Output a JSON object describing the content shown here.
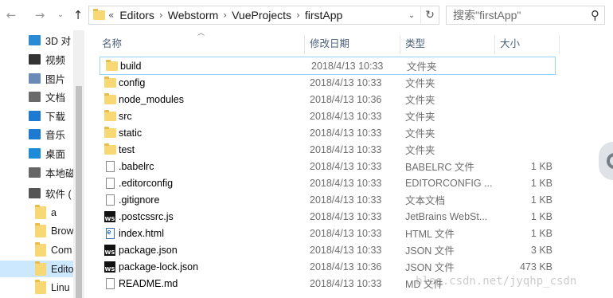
{
  "nav": {
    "back_icon": "back-arrow-icon",
    "forward_icon": "forward-arrow-icon",
    "recent_icon": "chevron-down-icon",
    "up_icon": "up-arrow-icon"
  },
  "address": {
    "overflow": "«",
    "crumbs": [
      "Editors",
      "Webstorm",
      "VueProjects",
      "firstApp"
    ],
    "separator": "›"
  },
  "search": {
    "placeholder": "搜索\"firstApp\""
  },
  "sidebar": {
    "items": [
      {
        "label": "3D 对",
        "icon": "3d-objects-icon"
      },
      {
        "label": "视频",
        "icon": "video-icon"
      },
      {
        "label": "图片",
        "icon": "pictures-icon"
      },
      {
        "label": "文档",
        "icon": "documents-icon"
      },
      {
        "label": "下载",
        "icon": "download-icon"
      },
      {
        "label": "音乐",
        "icon": "music-icon"
      },
      {
        "label": "桌面",
        "icon": "desktop-icon"
      },
      {
        "label": "本地磁",
        "icon": "local-disk-icon"
      },
      {
        "label": "软件 (",
        "icon": "drive-icon"
      },
      {
        "label": "a",
        "icon": "folder-icon"
      },
      {
        "label": "Brow",
        "icon": "folder-icon"
      },
      {
        "label": "Com",
        "icon": "folder-icon"
      },
      {
        "label": "Edito",
        "icon": "folder-icon",
        "selected": true
      },
      {
        "label": "Linu",
        "icon": "folder-icon"
      }
    ]
  },
  "columns": {
    "name": "名称",
    "date": "修改日期",
    "type": "类型",
    "size": "大小"
  },
  "files": [
    {
      "name": "build",
      "date": "2018/4/13 10:33",
      "type": "文件夹",
      "size": "",
      "icon": "folder-icon"
    },
    {
      "name": "config",
      "date": "2018/4/13 10:33",
      "type": "文件夹",
      "size": "",
      "icon": "folder-icon"
    },
    {
      "name": "node_modules",
      "date": "2018/4/13 10:36",
      "type": "文件夹",
      "size": "",
      "icon": "folder-icon"
    },
    {
      "name": "src",
      "date": "2018/4/13 10:33",
      "type": "文件夹",
      "size": "",
      "icon": "folder-icon"
    },
    {
      "name": "static",
      "date": "2018/4/13 10:33",
      "type": "文件夹",
      "size": "",
      "icon": "folder-icon"
    },
    {
      "name": "test",
      "date": "2018/4/13 10:33",
      "type": "文件夹",
      "size": "",
      "icon": "folder-icon"
    },
    {
      "name": ".babelrc",
      "date": "2018/4/13 10:33",
      "type": "BABELRC 文件",
      "size": "1 KB",
      "icon": "file-icon"
    },
    {
      "name": ".editorconfig",
      "date": "2018/4/13 10:33",
      "type": "EDITORCONFIG ...",
      "size": "1 KB",
      "icon": "file-icon"
    },
    {
      "name": ".gitignore",
      "date": "2018/4/13 10:33",
      "type": "文本文档",
      "size": "1 KB",
      "icon": "file-icon"
    },
    {
      "name": ".postcssrc.js",
      "date": "2018/4/13 10:33",
      "type": "JetBrains WebSt...",
      "size": "1 KB",
      "icon": "webstorm-icon"
    },
    {
      "name": "index.html",
      "date": "2018/4/13 10:33",
      "type": "HTML 文件",
      "size": "1 KB",
      "icon": "html-file-icon"
    },
    {
      "name": "package.json",
      "date": "2018/4/13 10:33",
      "type": "JSON 文件",
      "size": "3 KB",
      "icon": "webstorm-icon"
    },
    {
      "name": "package-lock.json",
      "date": "2018/4/13 10:36",
      "type": "JSON 文件",
      "size": "473 KB",
      "icon": "webstorm-icon"
    },
    {
      "name": "README.md",
      "date": "2018/4/13 10:33",
      "type": "MD 文件",
      "size": "",
      "icon": "file-icon"
    }
  ],
  "watermark": "blog.csdn.net/jyqhp_csdn"
}
